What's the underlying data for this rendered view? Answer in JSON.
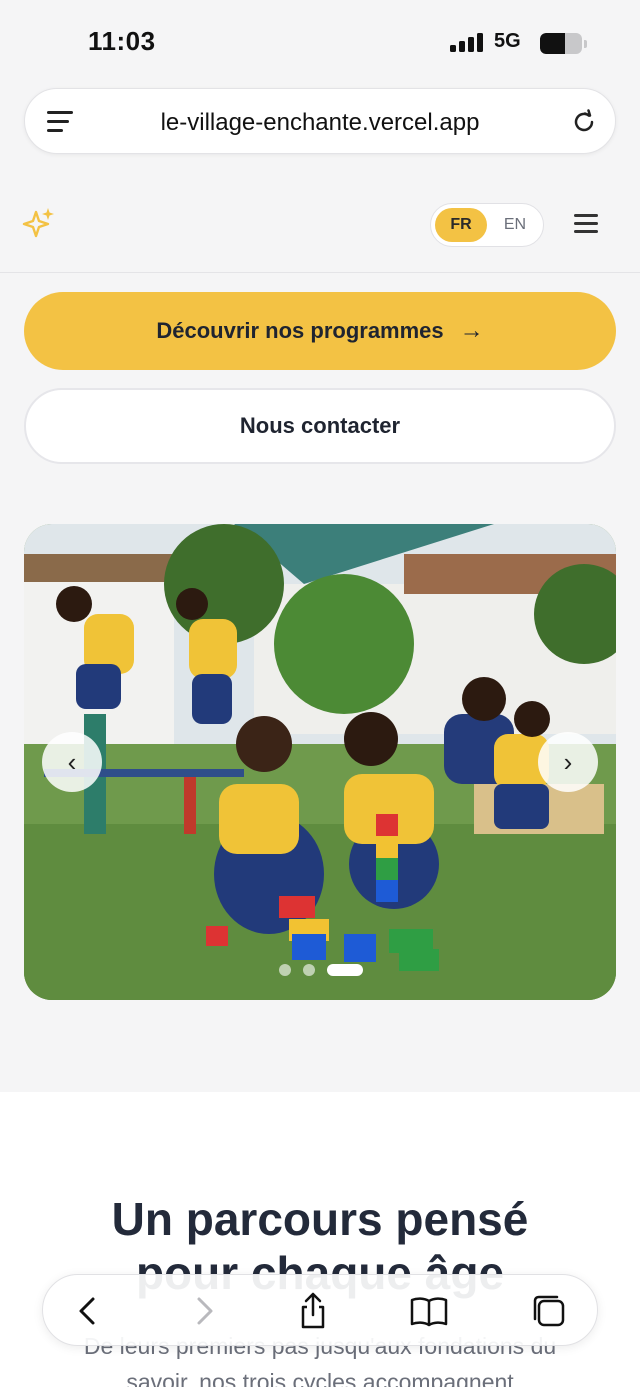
{
  "status_bar": {
    "time": "11:03",
    "network": "5G",
    "battery_level": 0.6
  },
  "browser": {
    "url": "le-village-enchante.vercel.app"
  },
  "header": {
    "languages": [
      "FR",
      "EN"
    ],
    "active_language": "FR",
    "logo_icon": "sparkle-icon",
    "accent_color": "#f3c244"
  },
  "hero": {
    "primary_cta": "Découvrir nos programmes",
    "primary_cta_icon": "arrow-right",
    "secondary_cta": "Nous contacter"
  },
  "carousel": {
    "slide_count": 3,
    "active_index": 2,
    "prev_icon": "chevron-left",
    "next_icon": "chevron-right"
  },
  "section": {
    "title": "Un parcours pensé pour chaque âge",
    "text": "De leurs premiers pas jusqu'aux fondations du savoir, nos trois cycles accompagnent"
  },
  "toolbar": {
    "items": [
      "back-icon",
      "forward-icon",
      "share-icon",
      "bookmarks-icon",
      "tabs-icon"
    ]
  }
}
